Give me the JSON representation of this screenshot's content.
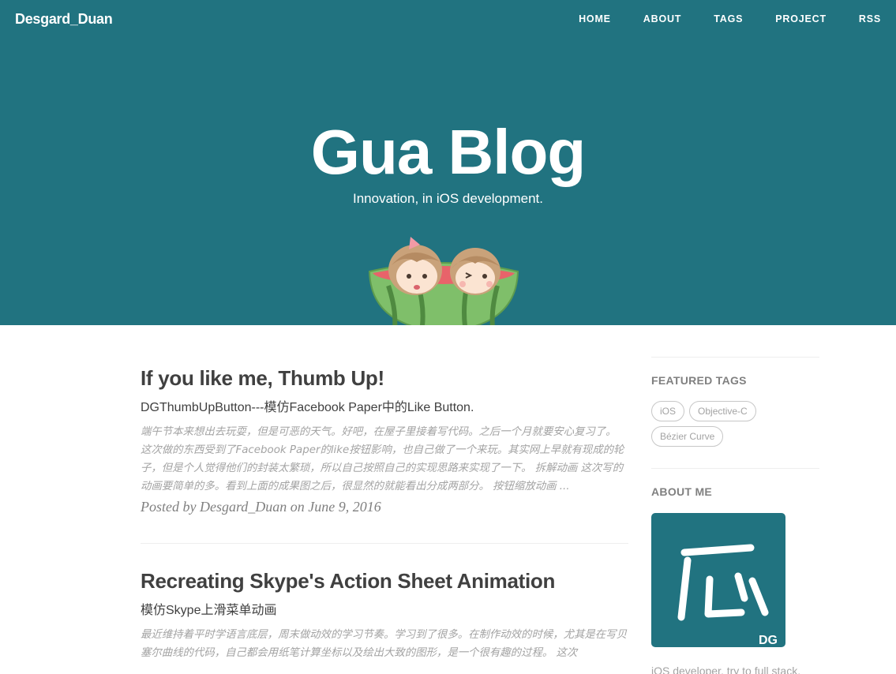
{
  "site": {
    "brand": "Desgard_Duan",
    "nav": [
      "HOME",
      "ABOUT",
      "TAGS",
      "PROJECT",
      "RSS"
    ],
    "title": "Gua Blog",
    "subtitle": "Innovation, in iOS development."
  },
  "posts": [
    {
      "title": "If you like me, Thumb Up!",
      "subtitle": "DGThumbUpButton---模仿Facebook Paper中的Like Button.",
      "excerpt": "端午节本来想出去玩耍，但是可恶的天气。好吧，在屋子里接着写代码。之后一个月就要安心复习了。 这次做的东西受到了Facebook Paper的like按钮影响，也自己做了一个来玩。其实网上早就有现成的轮子，但是个人觉得他们的封装太繁琐，所以自己按照自己的实现思路来实现了一下。 拆解动画 这次写的动画要简单的多。看到上面的成果图之后，很显然的就能看出分成两部分。 按钮缩放动画 ...",
      "meta": "Posted by Desgard_Duan on June 9, 2016"
    },
    {
      "title": "Recreating Skype's Action Sheet Animation",
      "subtitle": "模仿Skype上滑菜单动画",
      "excerpt": "最近维持着平时学语言底层，周末做动效的学习节奏。学习到了很多。在制作动效的时候，尤其是在写贝塞尔曲线的代码，自己都会用纸笔计算坐标以及绘出大致的图形，是一个很有趣的过程。 这次"
    }
  ],
  "sidebar": {
    "featured_heading": "FEATURED TAGS",
    "tags": [
      "iOS",
      "Objective-C",
      "Bézier Curve"
    ],
    "about_heading": "ABOUT ME",
    "avatar_glyph": "瓜",
    "avatar_badge": "DG",
    "about_text": "iOS developer, try to full stack."
  },
  "colors": {
    "header": "#217380",
    "text": "#404040",
    "muted": "#a3a3a3"
  },
  "icons": {
    "mascot": "watermelon-couple-illustration",
    "avatar": "gua-logo"
  }
}
